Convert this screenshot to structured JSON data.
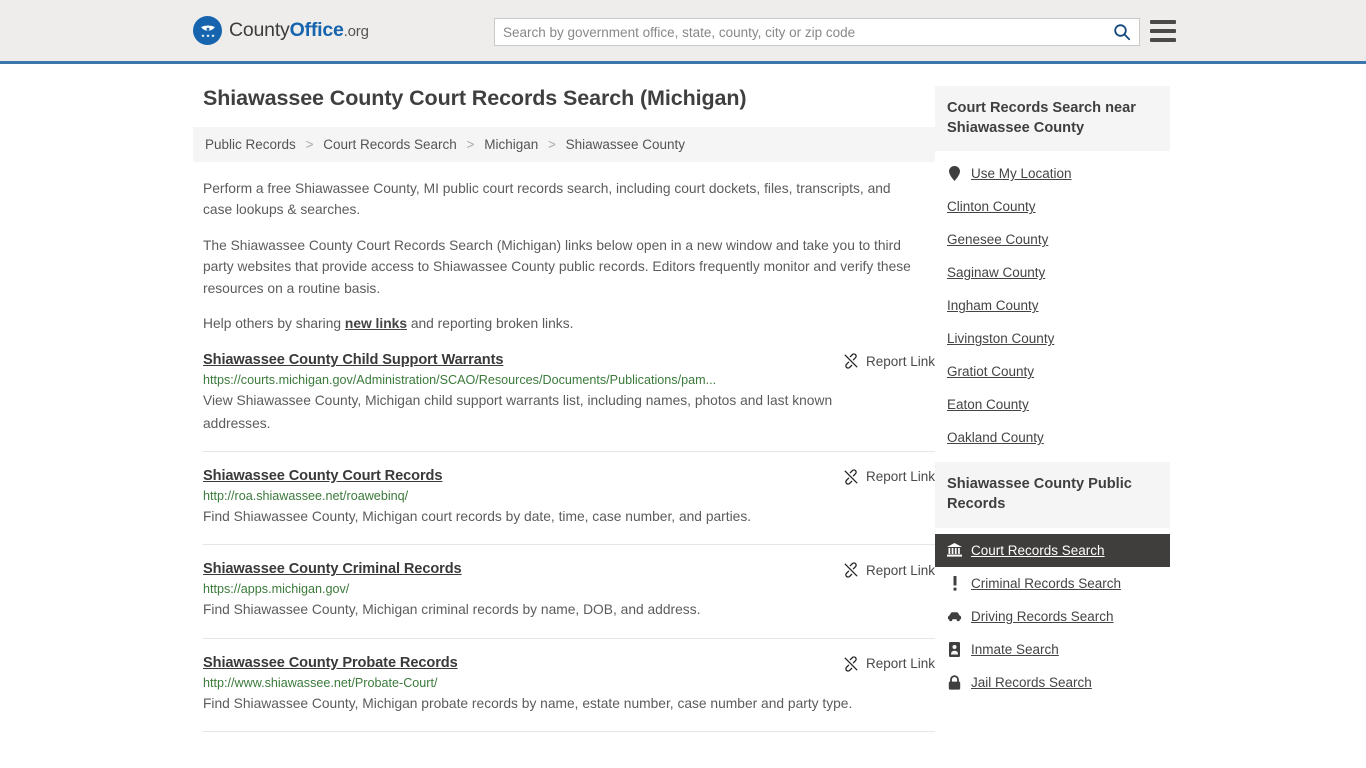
{
  "header": {
    "logo_text_1": "County",
    "logo_text_2": "Office",
    "logo_text_3": ".org",
    "logo_icon": "eagle-seal-icon",
    "search_placeholder": "Search by government office, state, county, city or zip code",
    "search_value": "",
    "search_icon": "search-icon",
    "menu_icon": "hamburger-menu-icon"
  },
  "main": {
    "title": "Shiawassee County Court Records Search (Michigan)",
    "breadcrumb": [
      {
        "label": "Public Records",
        "current": false
      },
      {
        "label": "Court Records Search",
        "current": false
      },
      {
        "label": "Michigan",
        "current": false
      },
      {
        "label": "Shiawassee County",
        "current": true
      }
    ],
    "breadcrumb_separator": ">",
    "paragraph_1": "Perform a free Shiawassee County, MI public court records search, including court dockets, files, transcripts, and case lookups & searches.",
    "paragraph_2": "The Shiawassee County Court Records Search (Michigan) links below open in a new window and take you to third party websites that provide access to Shiawassee County public records. Editors frequently monitor and verify these resources on a routine basis.",
    "paragraph_3_pre": "Help others by sharing ",
    "paragraph_3_link": "new links",
    "paragraph_3_post": " and reporting broken links.",
    "report_link_label": "Report Link",
    "report_link_icon": "broken-link-icon",
    "results": [
      {
        "title": "Shiawassee County Child Support Warrants",
        "url": "https://courts.michigan.gov/Administration/SCAO/Resources/Documents/Publications/pam...",
        "description": "View Shiawassee County, Michigan child support warrants list, including names, photos and last known addresses."
      },
      {
        "title": "Shiawassee County Court Records",
        "url": "http://roa.shiawassee.net/roawebinq/",
        "description": "Find Shiawassee County, Michigan court records by date, time, case number, and parties."
      },
      {
        "title": "Shiawassee County Criminal Records",
        "url": "https://apps.michigan.gov/",
        "description": "Find Shiawassee County, Michigan criminal records by name, DOB, and address."
      },
      {
        "title": "Shiawassee County Probate Records",
        "url": "http://www.shiawassee.net/Probate-Court/",
        "description": "Find Shiawassee County, Michigan probate records by name, estate number, case number and party type."
      }
    ]
  },
  "sidebar": {
    "nearby": {
      "heading": "Court Records Search near Shiawassee County",
      "use_my_location": {
        "label": "Use My Location",
        "icon": "map-pin-icon"
      },
      "counties": [
        "Clinton County",
        "Genesee County",
        "Saginaw County",
        "Ingham County",
        "Livingston County",
        "Gratiot County",
        "Eaton County",
        "Oakland County"
      ]
    },
    "public_records": {
      "heading": "Shiawassee County Public Records",
      "items": [
        {
          "label": "Court Records Search",
          "icon": "courthouse-icon",
          "active": true
        },
        {
          "label": "Criminal Records Search",
          "icon": "exclamation-icon",
          "active": false
        },
        {
          "label": "Driving Records Search",
          "icon": "car-icon",
          "active": false
        },
        {
          "label": "Inmate Search",
          "icon": "id-card-icon",
          "active": false
        },
        {
          "label": "Jail Records Search",
          "icon": "lock-icon",
          "active": false
        }
      ]
    }
  },
  "colors": {
    "brand_blue": "#1564ad",
    "header_border": "#3b77ad",
    "header_bg": "#eeedec",
    "panel_bg": "#f5f5f5",
    "active_bg": "#403e3c",
    "url_green": "#3b7a3b"
  }
}
